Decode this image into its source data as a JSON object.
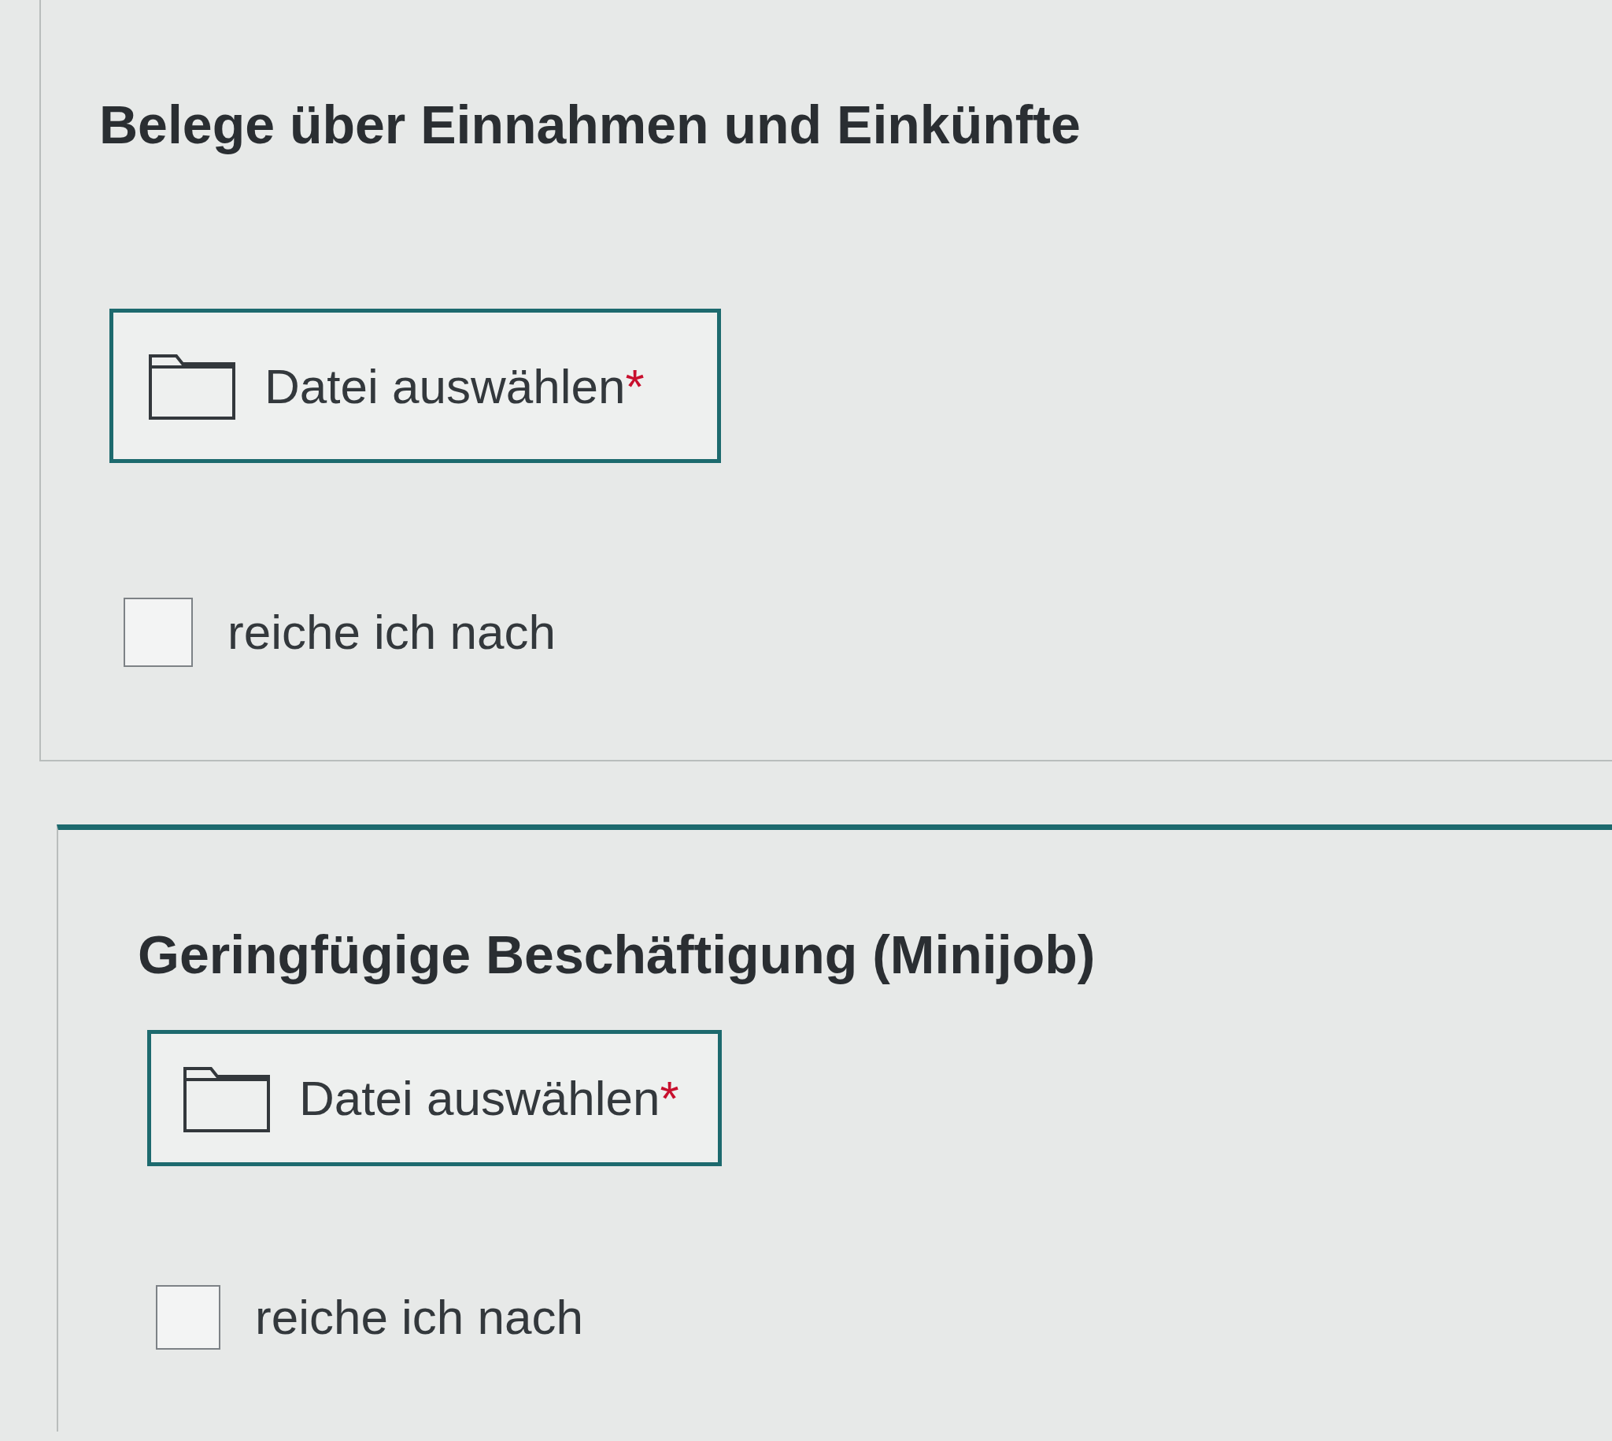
{
  "sections": [
    {
      "kind": "plain",
      "heading": "Belege über Einnahmen und Einkünfte",
      "upload": {
        "label": "Datei auswählen",
        "required_mark": "*"
      },
      "checkbox": {
        "label": "reiche ich nach",
        "checked": false
      }
    },
    {
      "kind": "highlighted",
      "heading": "Geringfügige Beschäftigung (Minijob)",
      "upload": {
        "label": "Datei auswählen",
        "required_mark": "*"
      },
      "checkbox": {
        "label": "reiche ich nach",
        "checked": false
      }
    }
  ]
}
